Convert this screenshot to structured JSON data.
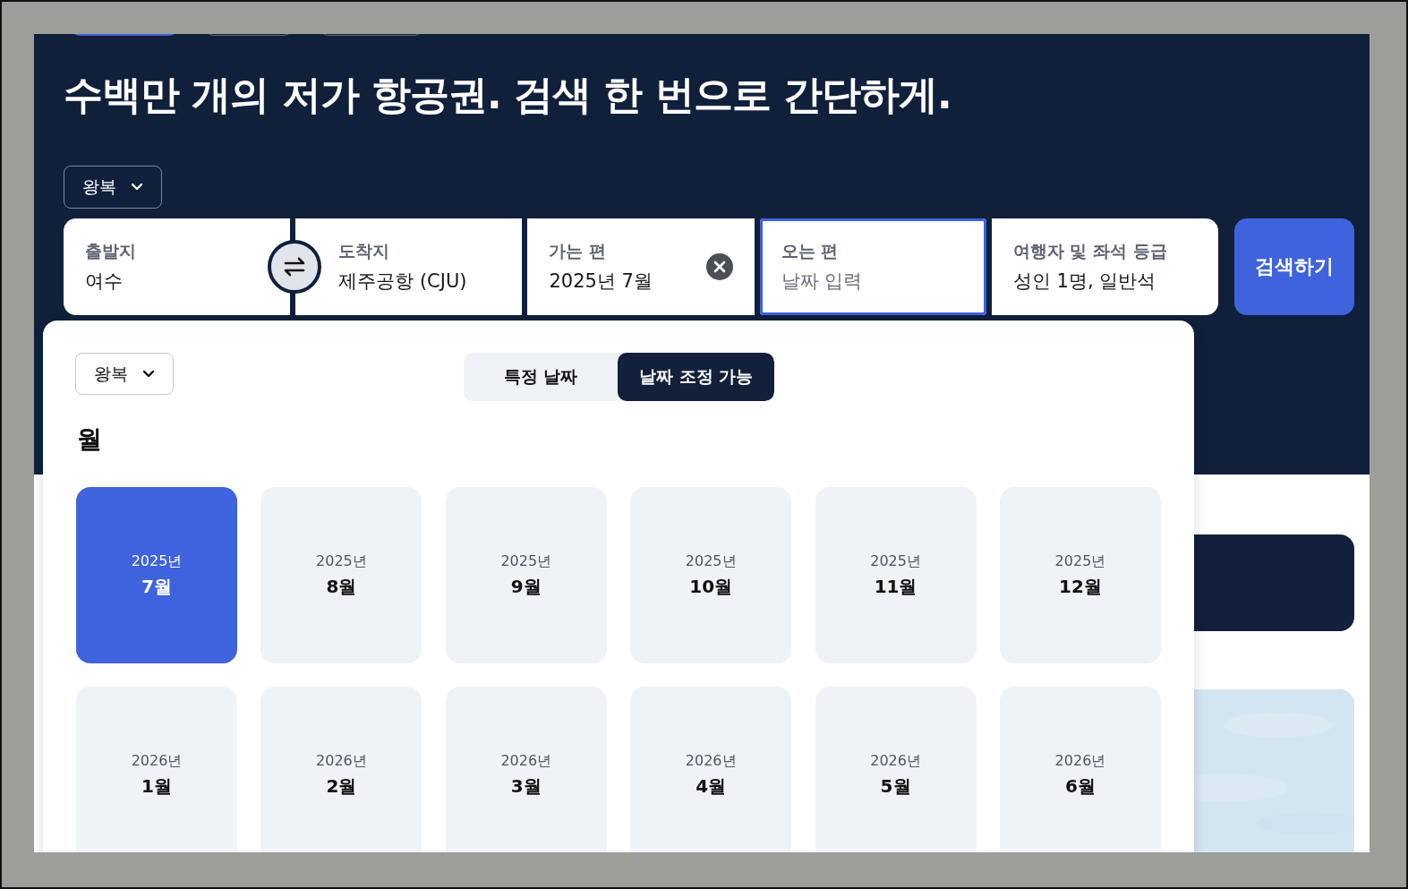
{
  "headline": "수백만 개의 저가 항공권. 검색 한 번으로 간단하게.",
  "trip_type": {
    "label": "왕복"
  },
  "search_fields": [
    {
      "label": "출발지",
      "value": "여수",
      "selected": false,
      "clearable": false
    },
    {
      "label": "도착지",
      "value": "제주공항 (CJU)",
      "selected": false,
      "clearable": false
    },
    {
      "label": "가는 편",
      "value": "2025년 7월",
      "selected": false,
      "clearable": true
    },
    {
      "label": "오는 편",
      "placeholder": "날짜 입력",
      "selected": true,
      "clearable": false
    },
    {
      "label": "여행자 및 좌석 등급",
      "value": "성인 1명, 일반석",
      "selected": false,
      "clearable": false
    }
  ],
  "search_button": "검색하기",
  "date_picker": {
    "trip_type": "왕복",
    "modes": [
      {
        "label": "특정 날짜",
        "selected": false
      },
      {
        "label": "날짜 조정 가능",
        "selected": true
      }
    ],
    "section_title": "월",
    "months": [
      {
        "year": "2025년",
        "month": "7월",
        "selected": true
      },
      {
        "year": "2025년",
        "month": "8월",
        "selected": false
      },
      {
        "year": "2025년",
        "month": "9월",
        "selected": false
      },
      {
        "year": "2025년",
        "month": "10월",
        "selected": false
      },
      {
        "year": "2025년",
        "month": "11월",
        "selected": false
      },
      {
        "year": "2025년",
        "month": "12월",
        "selected": false
      },
      {
        "year": "2026년",
        "month": "1월",
        "selected": false
      },
      {
        "year": "2026년",
        "month": "2월",
        "selected": false
      },
      {
        "year": "2026년",
        "month": "3월",
        "selected": false
      },
      {
        "year": "2026년",
        "month": "4월",
        "selected": false
      },
      {
        "year": "2026년",
        "month": "5월",
        "selected": false
      },
      {
        "year": "2026년",
        "month": "6월",
        "selected": false
      }
    ]
  }
}
